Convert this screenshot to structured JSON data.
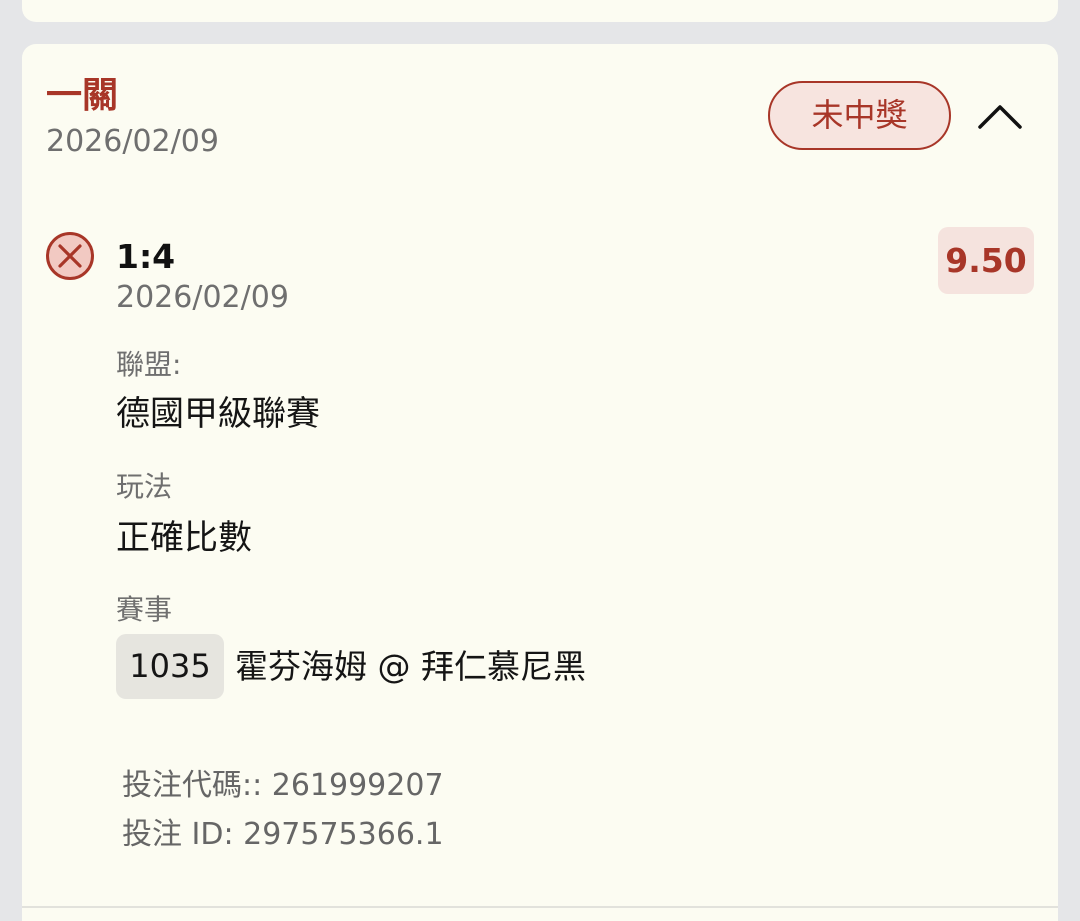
{
  "card": {
    "title": "一關",
    "date": "2026/02/09",
    "status": "未中獎",
    "colors": {
      "accent": "#a83628",
      "card_bg": "#fcfcf2",
      "badge_bg": "#f7e4df"
    },
    "icons": {
      "collapse": "chevron-up-icon",
      "result": "x-circle-icon"
    }
  },
  "leg": {
    "score": "1:4",
    "date": "2026/02/09",
    "odds": "9.50",
    "league_label": "聯盟:",
    "league": "德國甲級聯賽",
    "market_label": "玩法",
    "market": "正確比數",
    "event_label": "賽事",
    "event_number": "1035",
    "event_name": "霍芬海姆 @ 拜仁慕尼黑"
  },
  "bet": {
    "code": "投注代碼:: 261999207",
    "id": "投注 ID: 297575366.1"
  }
}
